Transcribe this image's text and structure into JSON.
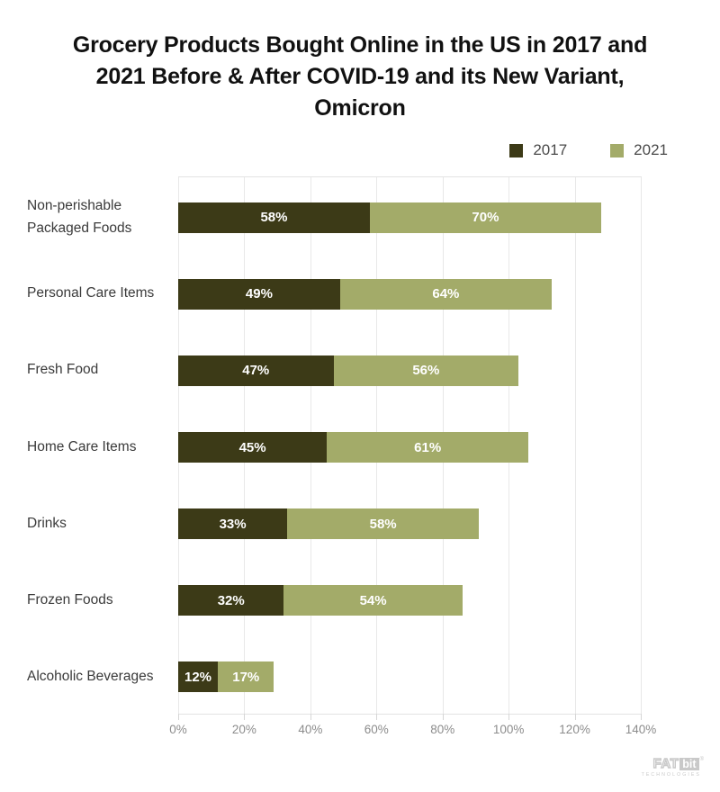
{
  "title": "Grocery Products Bought Online in the US in 2017 and 2021 Before & After COVID-19 and its New Variant, Omicron",
  "colors": {
    "series_2017": "#3c3a17",
    "series_2021": "#a3ab69",
    "grid": "#e8e8e8",
    "axis_text": "#8c8c8c",
    "label_text": "#3a3a3a",
    "value_text": "#ffffff"
  },
  "legend": {
    "position": "top-right",
    "items": [
      {
        "label": "2017",
        "color": "#3c3a17",
        "swatch_name": "legend-swatch-2017"
      },
      {
        "label": "2021",
        "color": "#a3ab69",
        "swatch_name": "legend-swatch-2021"
      }
    ]
  },
  "footer": {
    "logo_main": "FAT",
    "logo_accent": "bit",
    "logo_tm": "®",
    "logo_sub": "TECHNOLOGIES"
  },
  "chart_data": {
    "type": "bar",
    "orientation": "horizontal",
    "stacked": true,
    "title": "Grocery Products Bought Online in the US in 2017 and 2021 Before & After COVID-19 and its New Variant, Omicron",
    "xlabel": "",
    "ylabel": "",
    "xlim": [
      0,
      140
    ],
    "grid": true,
    "legend_position": "top-right",
    "tick_labels": [
      "0%",
      "20%",
      "40%",
      "60%",
      "80%",
      "100%",
      "120%",
      "140%"
    ],
    "ticks": [
      0,
      20,
      40,
      60,
      80,
      100,
      120,
      140
    ],
    "categories": [
      "Non-perishable Packaged Foods",
      "Personal Care Items",
      "Fresh Food",
      "Home Care Items",
      "Drinks",
      "Frozen Foods",
      "Alcoholic Beverages"
    ],
    "series": [
      {
        "name": "2017",
        "color": "#3c3a17",
        "values": [
          58,
          49,
          47,
          45,
          33,
          32,
          12
        ],
        "labels": [
          "58%",
          "49%",
          "47%",
          "45%",
          "33%",
          "32%",
          "12%"
        ]
      },
      {
        "name": "2021",
        "color": "#a3ab69",
        "values": [
          70,
          64,
          56,
          61,
          58,
          54,
          17
        ],
        "labels": [
          "70%",
          "64%",
          "56%",
          "61%",
          "58%",
          "54%",
          "17%"
        ]
      }
    ]
  }
}
